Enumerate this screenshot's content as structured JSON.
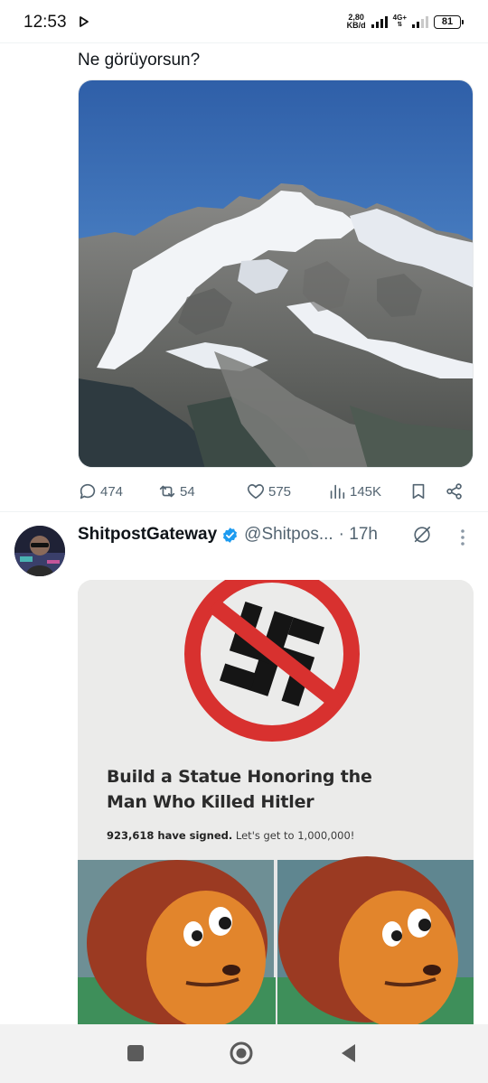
{
  "status_bar": {
    "time": "12:53",
    "net_speed_value": "2,80",
    "net_speed_unit": "KB/d",
    "network_type": "4G+",
    "battery": "81"
  },
  "tweet1": {
    "text": "Ne görüyorsun?",
    "image_icon": "mountain-photo",
    "actions": {
      "replies": "474",
      "reposts": "54",
      "likes": "575",
      "views": "145K"
    }
  },
  "tweet2": {
    "display_name": "ShitpostGateway",
    "handle": "@Shitpos...",
    "time": "· 17h",
    "image": {
      "petition_title": "Build a Statue Honoring the Man Who Killed Hitler",
      "signed_count": "923,618 have signed.",
      "goal_text": "Let's get to 1,000,000!"
    }
  },
  "colors": {
    "text_primary": "#0f1419",
    "text_secondary": "#536471",
    "verified_blue": "#1d9bf0",
    "divider": "#eff3f4"
  }
}
